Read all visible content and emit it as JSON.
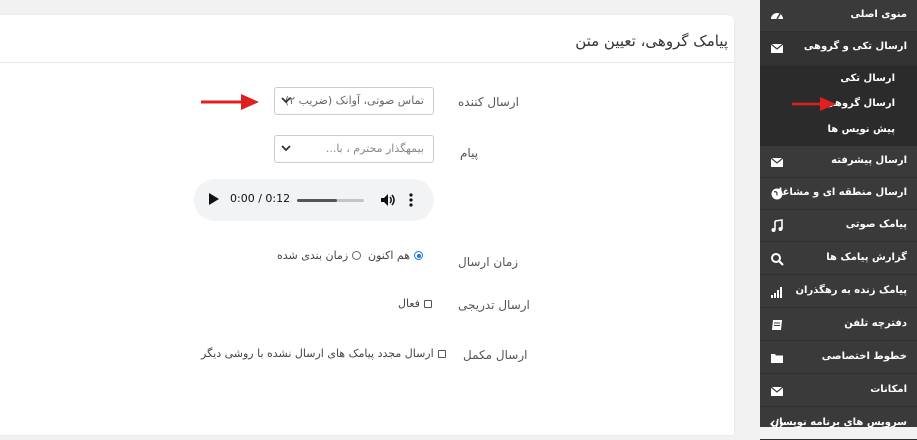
{
  "card": {
    "title": "پیامک گروهی، تعیین متن"
  },
  "form": {
    "sender": {
      "label": "ارسال کننده",
      "value": "تماس صوتی، آوانک (ضریب ۲)"
    },
    "message": {
      "label": "پیام",
      "placeholder": "بیمهگذار محترم ، با..."
    },
    "audio": {
      "time": "0:00 / 0:12",
      "progress_fraction": 0.6
    },
    "send_time": {
      "label": "زمان ارسال",
      "options": [
        "هم اکنون",
        "زمان بندی شده"
      ],
      "selected": "هم اکنون"
    },
    "gradual": {
      "label": "ارسال تدریجی",
      "checkbox_label": "فعال",
      "checked": false
    },
    "complementary": {
      "label": "ارسال مکمل",
      "checkbox_label": "ارسال مجدد پیامک های ارسال نشده با روشی دیگر",
      "checked": false
    }
  },
  "sidebar": {
    "items": [
      {
        "label": "منوی اصلی",
        "icon": "dashboard-icon"
      },
      {
        "label": "ارسال تکی و گروهی",
        "icon": "envelope-icon"
      },
      {
        "label": "ارسال پیشرفته",
        "icon": "envelope-icon"
      },
      {
        "label": "ارسال منطقه ای و مشاغل",
        "icon": "globe-icon"
      },
      {
        "label": "پیامک صوتی",
        "icon": "music-icon"
      },
      {
        "label": "گزارش پیامک ها",
        "icon": "search-icon"
      },
      {
        "label": "پیامک زنده به رهگذران",
        "icon": "signal-icon"
      },
      {
        "label": "دفترچه تلفن",
        "icon": "book-icon"
      },
      {
        "label": "خطوط اختصاصی",
        "icon": "folder-icon"
      },
      {
        "label": "امکانات",
        "icon": "envelope-icon"
      },
      {
        "label": "سرویس های برنامه نویسان",
        "icon": "code-icon"
      }
    ],
    "submenu": [
      "ارسال تکی",
      "ارسال گروهی",
      "پیش نویس ها"
    ]
  },
  "colors": {
    "sidebar_bg": "#3a3a3a",
    "arrow": "#e02020",
    "radio_accent": "#1a73e8"
  }
}
